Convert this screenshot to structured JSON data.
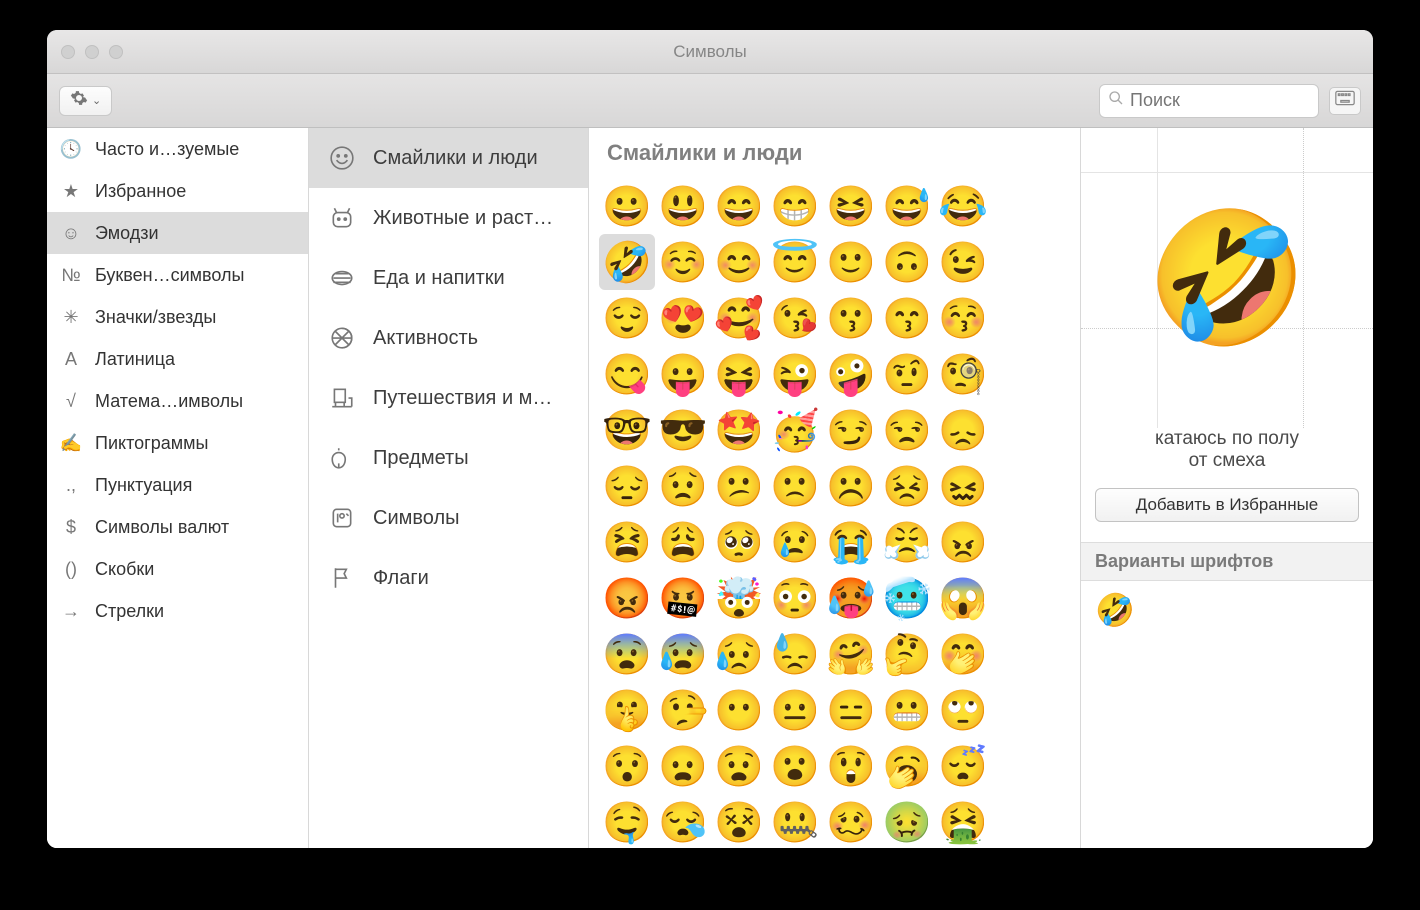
{
  "window": {
    "title": "Символы",
    "search_placeholder": "Поиск"
  },
  "sidebar": {
    "selected_index": 2,
    "items": [
      {
        "icon": "🕓",
        "label": "Часто и…зуемые"
      },
      {
        "icon": "★",
        "label": "Избранное"
      },
      {
        "icon": "☺",
        "label": "Эмодзи"
      },
      {
        "icon": "№",
        "label": "Буквен…символы"
      },
      {
        "icon": "✳",
        "label": "Значки/звезды"
      },
      {
        "icon": "A",
        "label": "Латиница"
      },
      {
        "icon": "√",
        "label": "Матема…имволы"
      },
      {
        "icon": "✍",
        "label": "Пиктограммы"
      },
      {
        "icon": ".,",
        "label": "Пунктуация"
      },
      {
        "icon": "$",
        "label": "Символы валют"
      },
      {
        "icon": "()",
        "label": "Скобки"
      },
      {
        "icon": "→",
        "label": "Стрелки"
      }
    ]
  },
  "categories": {
    "selected_index": 0,
    "items": [
      {
        "label": "Смайлики и люди"
      },
      {
        "label": "Животные и раст…"
      },
      {
        "label": "Еда и напитки"
      },
      {
        "label": "Активность"
      },
      {
        "label": "Путешествия и м…"
      },
      {
        "label": "Предметы"
      },
      {
        "label": "Символы"
      },
      {
        "label": "Флаги"
      }
    ]
  },
  "grid": {
    "title": "Смайлики и люди",
    "selected": [
      1,
      0
    ],
    "rows": [
      [
        "😀",
        "😃",
        "😄",
        "😁",
        "😆",
        "😅",
        "😂"
      ],
      [
        "🤣",
        "☺️",
        "😊",
        "😇",
        "🙂",
        "🙃",
        "😉"
      ],
      [
        "😌",
        "😍",
        "🥰",
        "😘",
        "😗",
        "😙",
        "😚"
      ],
      [
        "😋",
        "😛",
        "😝",
        "😜",
        "🤪",
        "🤨",
        "🧐"
      ],
      [
        "🤓",
        "😎",
        "🤩",
        "🥳",
        "😏",
        "😒",
        "😞"
      ],
      [
        "😔",
        "😟",
        "😕",
        "🙁",
        "☹️",
        "😣",
        "😖"
      ],
      [
        "😫",
        "😩",
        "🥺",
        "😢",
        "😭",
        "😤",
        "😠"
      ],
      [
        "😡",
        "🤬",
        "🤯",
        "😳",
        "🥵",
        "🥶",
        "😱"
      ],
      [
        "😨",
        "😰",
        "😥",
        "😓",
        "🤗",
        "🤔",
        "🤭"
      ],
      [
        "🤫",
        "🤥",
        "😶",
        "😐",
        "😑",
        "😬",
        "🙄"
      ],
      [
        "😯",
        "😦",
        "😧",
        "😮",
        "😲",
        "🥱",
        "😴"
      ],
      [
        "🤤",
        "😪",
        "😵",
        "🤐",
        "🥴",
        "🤢",
        "🤮"
      ]
    ]
  },
  "preview": {
    "emoji": "🤣",
    "name_line1": "катаюсь по полу",
    "name_line2": "от смеха",
    "add_favorites": "Добавить в Избранные",
    "variants_header": "Варианты шрифтов",
    "variants": [
      "🤣"
    ]
  }
}
